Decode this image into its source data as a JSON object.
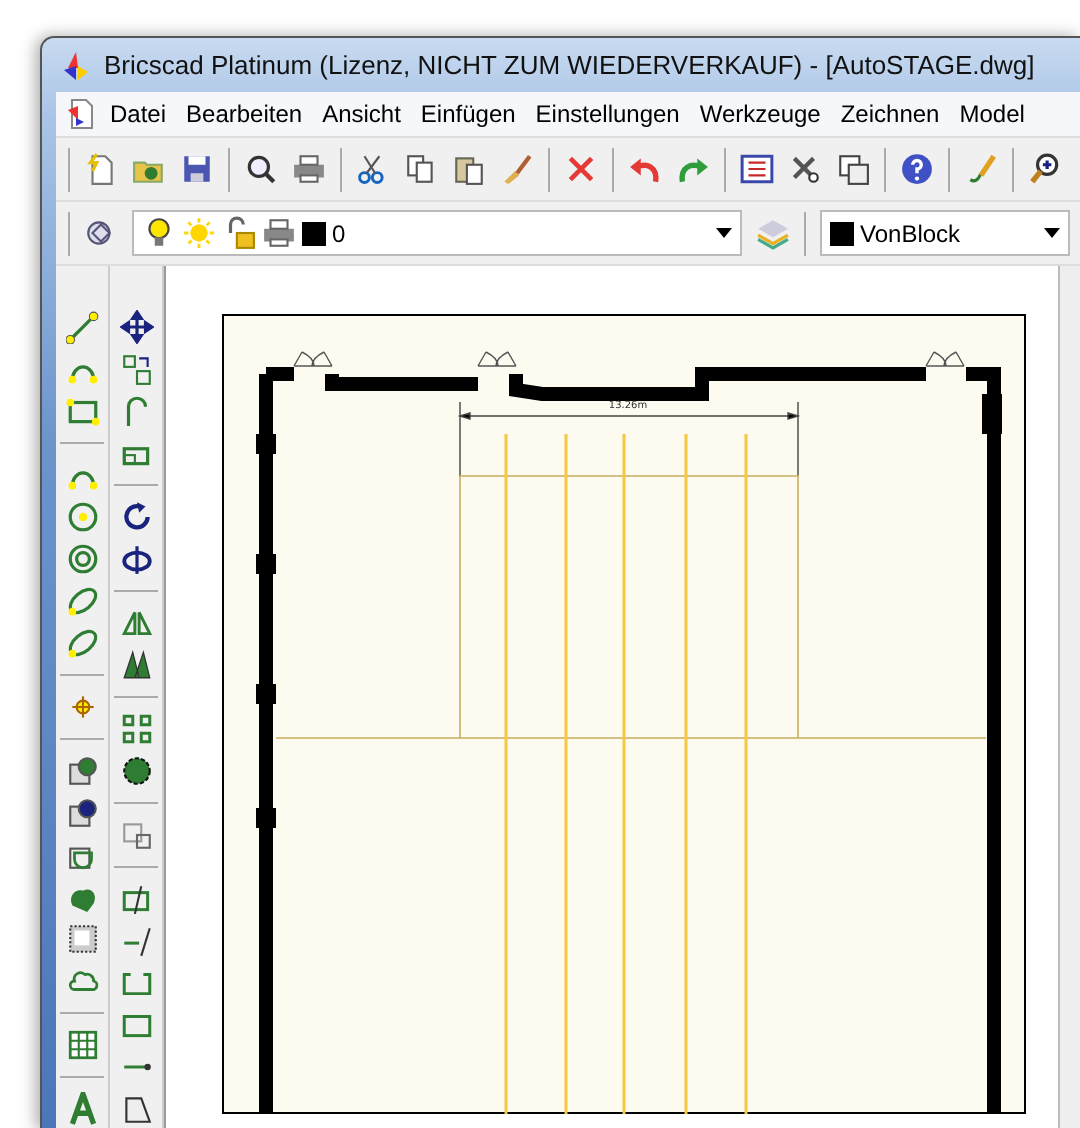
{
  "window": {
    "title": "Bricscad Platinum (Lizenz, NICHT ZUM WIEDERVERKAUF) - [AutoSTAGE.dwg]"
  },
  "menu": [
    "Datei",
    "Bearbeiten",
    "Ansicht",
    "Einfügen",
    "Einstellungen",
    "Werkzeuge",
    "Zeichnen",
    "Model"
  ],
  "layer_toolbar": {
    "layer": "0",
    "color_field": "VonBlock"
  },
  "drawing": {
    "dimension": "13.26m"
  }
}
